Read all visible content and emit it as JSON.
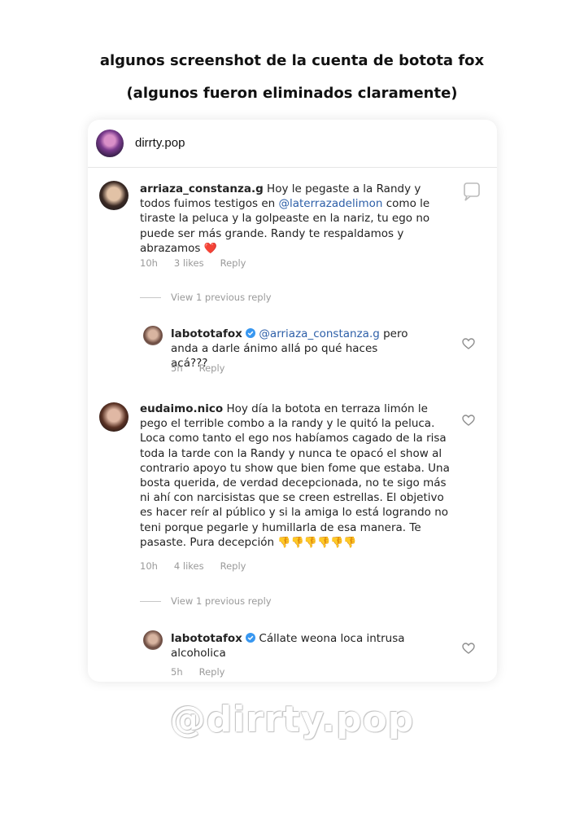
{
  "headline": {
    "line1": "algunos screenshot de la cuenta de botota fox",
    "line2": "(algunos fueron eliminados claramente)"
  },
  "post": {
    "username": "dirrty.pop"
  },
  "comments": [
    {
      "user": "arriaza_constanza.g",
      "text_a": " Hoy le pegaste a la Randy y todos fuimos testigos en ",
      "mention": "@laterrazadelimon",
      "text_b": " como le tiraste la peluca y la golpeaste en la nariz, tu ego no puede ser más grande. Randy te respaldamos y abrazamos ",
      "emoji": "❤️",
      "time": "10h",
      "likes": "3 likes",
      "reply": "Reply",
      "view_previous": "View 1 previous reply",
      "reply_comment": {
        "user": "labototafox",
        "mention": "@arriaza_constanza.g",
        "text": " pero anda a darle ánimo allá po qué haces acá???",
        "time": "5h",
        "reply": "Reply"
      }
    },
    {
      "user": "eudaimo.nico",
      "text": " Hoy día la botota en terraza limón  le pego el terrible combo a la randy y le quitó la peluca. Loca como tanto el ego nos habíamos cagado de la risa toda la tarde con la Randy y nunca te opacó  el show al contrario apoyo tu show que bien fome que estaba. Una bosta querida, de verdad decepcionada, no te sigo más  ni ahí con narcisistas que se creen estrellas. El objetivo es hacer reír al público y si la amiga lo está logrando no teni porque pegarle y humillarla de esa manera. Te pasaste. Pura decepción ",
      "emoji": "👎👎👎👎👎👎",
      "time": "10h",
      "likes": "4 likes",
      "reply": "Reply",
      "view_previous": "View 1 previous reply",
      "reply_comment": {
        "user": "labototafox",
        "text": " Cállate weona loca intrusa alcoholica",
        "time": "5h",
        "reply": "Reply"
      }
    }
  ],
  "watermark": "@dirrty.pop",
  "colors": {
    "mention": "#2d5fa8",
    "verified": "#3897f0",
    "heart_emoji": "#e0245e",
    "meta": "#9a9a9a"
  }
}
